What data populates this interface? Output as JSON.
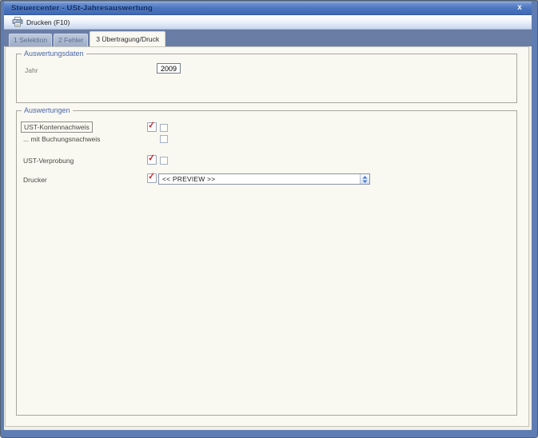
{
  "window": {
    "title": "Steuercenter - USt-Jahresauswertung"
  },
  "icons": {
    "close": "x",
    "check": "✓",
    "printer": "printer-icon",
    "dropdown": "up-down-arrows-icon"
  },
  "toolbar": {
    "print_button": "Drucken (F10)"
  },
  "tabs": [
    {
      "label": "1 Selektion",
      "active": false
    },
    {
      "label": "2 Fehler",
      "active": false
    },
    {
      "label": "3 Übertragung/Druck",
      "active": true
    }
  ],
  "auswertungsdaten": {
    "legend": "Auswertungsdaten",
    "jahr_label": "Jahr",
    "jahr_value": "2009"
  },
  "auswertungen": {
    "legend": "Auswertungen",
    "kontennachweis_label": "UST-Kontennachweis",
    "kontennachweis_selected": true,
    "buchungsnachweis_label": "... mit Buchungsnachweis",
    "buchungsnachweis_selected": false,
    "verprobung_label": "UST-Verprobung",
    "verprobung_selected": true,
    "drucker_label": "Drucker",
    "drucker_selected": true,
    "drucker_value": "<< PREVIEW >>"
  },
  "colors": {
    "frame_blue": "#5f7db2",
    "titlebar_blue": "#4c77c0",
    "tabstrip_blue": "#697da5",
    "page_bg": "#f9f8f1",
    "legend_blue": "#4a67a8",
    "check_red": "#cf2630"
  }
}
